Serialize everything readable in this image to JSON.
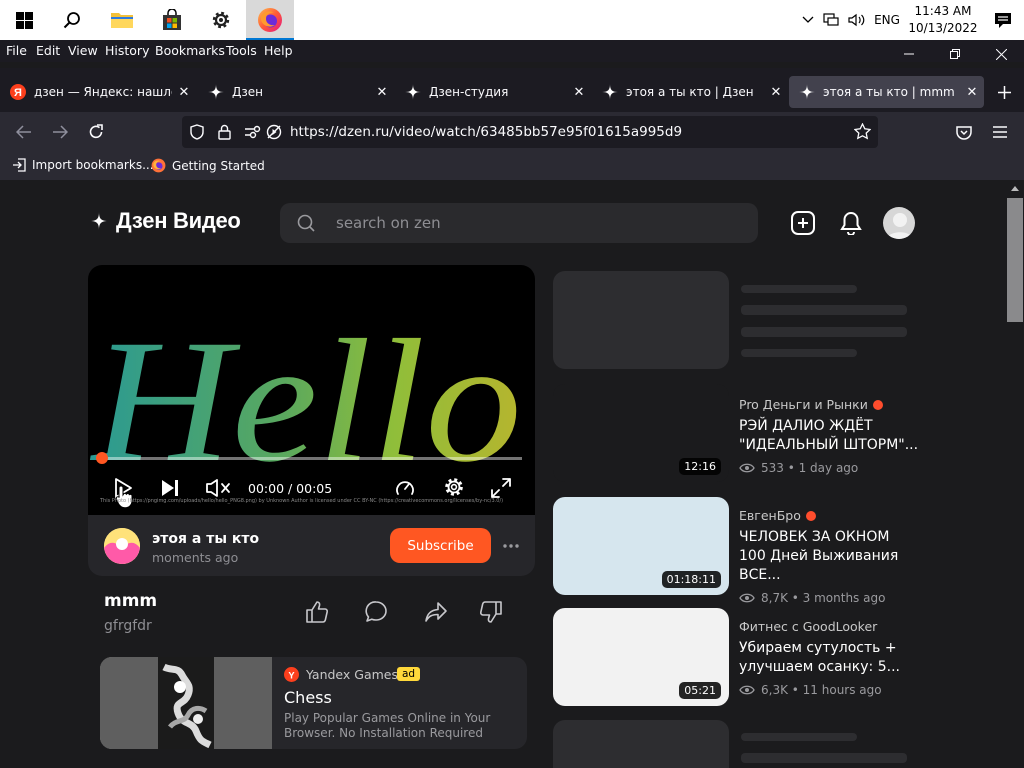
{
  "taskbar": {
    "time": "11:43 AM",
    "date": "10/13/2022",
    "lang": "ENG"
  },
  "menu": [
    "File",
    "Edit",
    "View",
    "History",
    "Bookmarks",
    "Tools",
    "Help"
  ],
  "tabs": [
    {
      "title": "дзен — Яндекс: нашлось"
    },
    {
      "title": "Дзен"
    },
    {
      "title": "Дзен-студия"
    },
    {
      "title": "этоя а ты кто | Дзен"
    },
    {
      "title": "этоя а ты кто | mmm"
    }
  ],
  "nav": {
    "url": "https://dzen.ru/video/watch/63485bb57e95f01615a995d9"
  },
  "bookmarks": [
    {
      "label": "Import bookmarks..."
    },
    {
      "label": "Getting Started"
    }
  ],
  "site": {
    "logo_text": "Дзен Видео",
    "search_placeholder": "search on zen"
  },
  "player": {
    "overlay_text": "Hello",
    "time": "00:00 / 00:05",
    "credit": "This Photo (https://pngimg.com/uploads/hello/hello_PNG8.png) by Unknown Author is licensed under CC BY-NC (https://creativecommons.org/licenses/by-nc/3.0/)",
    "progress": 0
  },
  "channel": {
    "name": "этоя а ты кто",
    "time": "moments ago",
    "subscribe": "Subscribe"
  },
  "video": {
    "title": "mmm",
    "description": "gfrgfdr"
  },
  "ad": {
    "source": "Yandex Games",
    "badge": "ad",
    "title": "Chess",
    "text": "Play Popular Games Online in Your Browser. No Installation Required"
  },
  "recommendations": [
    {
      "channel": "Pro Деньги и Рынки",
      "title": "РЭЙ ДАЛИО ЖДЁТ \"ИДЕАЛЬНЫЙ ШТОРМ\"...",
      "stats": "533 • 1 day ago",
      "duration": "12:16"
    },
    {
      "channel": "ЕвгенБро",
      "title": "ЧЕЛОВЕК ЗА ОКНОМ 100 Дней Выживания ВСЕ...",
      "stats": "8,7K • 3 months ago",
      "duration": "01:18:11"
    },
    {
      "channel": "Фитнес с GoodLooker",
      "title": "Убираем сутулость + улучшаем осанку: 5...",
      "stats": "6,3K • 11 hours ago",
      "duration": "05:21"
    }
  ],
  "colors": {
    "accent": "#ff5722",
    "progress": "#ff5722",
    "background": "#1b1b1d"
  }
}
